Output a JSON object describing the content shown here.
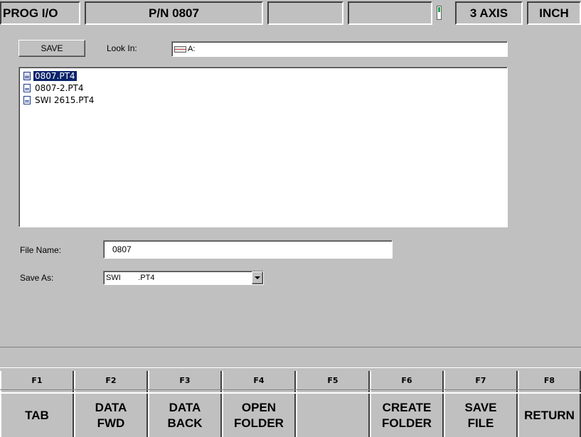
{
  "status_bar": {
    "mode": "PROG I/O",
    "part_number": "P/N 0807",
    "field_3": "",
    "field_4": "",
    "axis": "3 AXIS",
    "units": "INCH"
  },
  "colors": {
    "background": "#c0c0c0",
    "selection": "#0a246a",
    "status_led": "#1aa84a"
  },
  "dialog": {
    "save_button": "SAVE",
    "look_in_label": "Look In:",
    "look_in_icon": "drive-icon",
    "look_in_value": "A:",
    "files": [
      {
        "name": "0807.PT4",
        "selected": true
      },
      {
        "name": "0807-2.PT4",
        "selected": false
      },
      {
        "name": "SWI 2615.PT4",
        "selected": false
      }
    ],
    "file_name_label": "File Name:",
    "file_name_value": "0807",
    "save_as_label": "Save As:",
    "save_as_value": "SWI        .PT4"
  },
  "message_bar": "",
  "function_keys": [
    {
      "key": "F1",
      "label": "TAB"
    },
    {
      "key": "F2",
      "label": "DATA\nFWD"
    },
    {
      "key": "F3",
      "label": "DATA\nBACK"
    },
    {
      "key": "F4",
      "label": "OPEN\nFOLDER"
    },
    {
      "key": "F5",
      "label": ""
    },
    {
      "key": "F6",
      "label": "CREATE\nFOLDER"
    },
    {
      "key": "F7",
      "label": "SAVE\nFILE"
    },
    {
      "key": "F8",
      "label": "RETURN"
    }
  ]
}
